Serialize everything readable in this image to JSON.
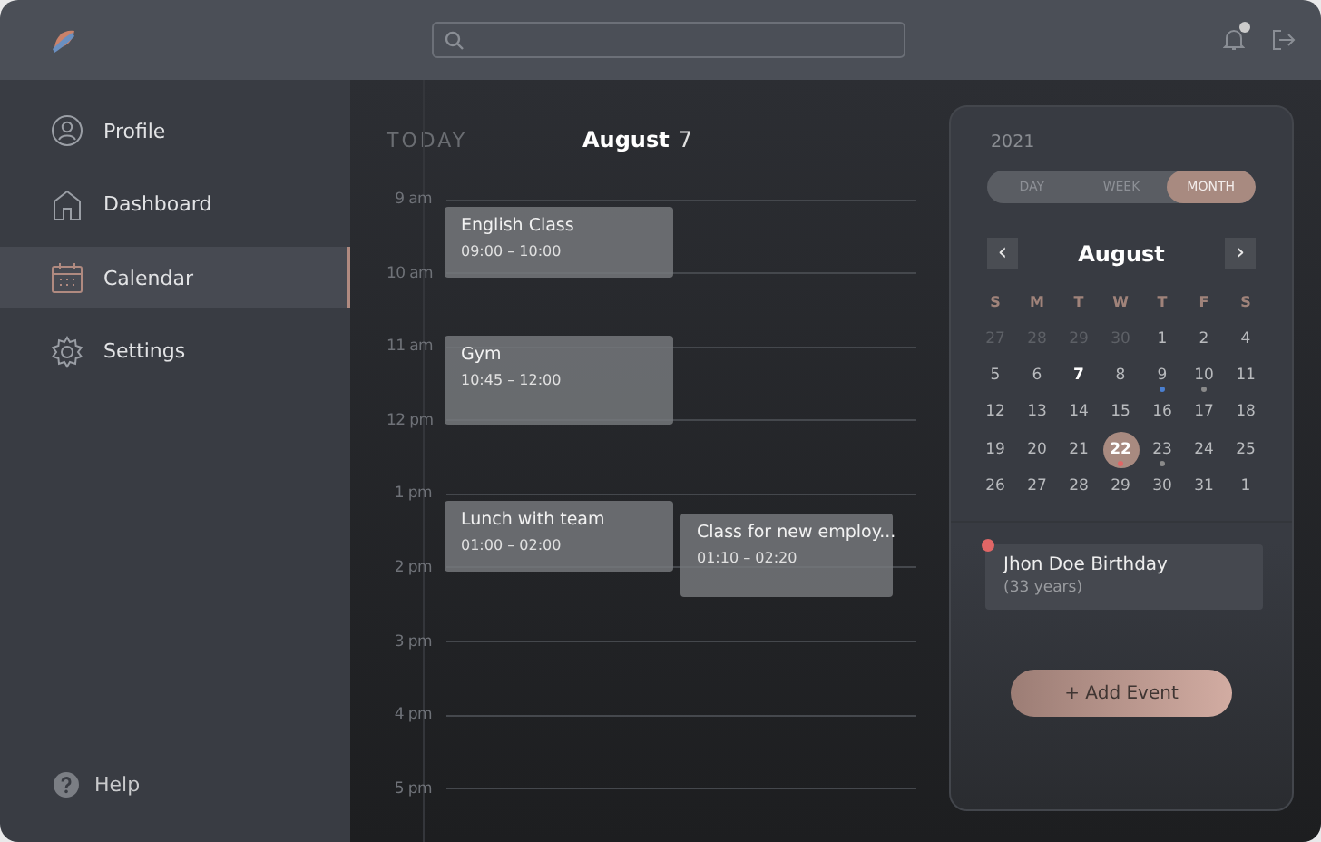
{
  "sidebar": {
    "items": [
      {
        "kind": "profile",
        "label": "Profile",
        "selected": false
      },
      {
        "kind": "dashboard",
        "label": "Dashboard",
        "selected": false
      },
      {
        "kind": "calendar",
        "label": "Calendar",
        "selected": true
      },
      {
        "kind": "settings",
        "label": "Settings",
        "selected": false
      }
    ],
    "help": "Help"
  },
  "day_view": {
    "today_label": "TODAY",
    "month": "August",
    "day": "7",
    "hours": [
      "9 am",
      "10 am",
      "11 am",
      "12 pm",
      "1 pm",
      "2 pm",
      "3 pm",
      "4 pm",
      "5 pm"
    ],
    "events": [
      {
        "title": "English Class",
        "time": "09:00 – 10:00"
      },
      {
        "title": "Gym",
        "time": "10:45 – 12:00"
      },
      {
        "title": "Lunch with team",
        "time": "01:00 – 02:00"
      },
      {
        "title": "Class for new employ...",
        "time": "01:10 – 02:20"
      }
    ]
  },
  "month_panel": {
    "year": "2021",
    "views": [
      {
        "label": "DAY",
        "selected": false
      },
      {
        "label": "WEEK",
        "selected": false
      },
      {
        "label": "MONTH",
        "selected": true
      }
    ],
    "prev": "‹",
    "month": "August",
    "next": "›",
    "weekdays": [
      "S",
      "M",
      "T",
      "W",
      "T",
      "F",
      "S"
    ],
    "days": [
      {
        "day": "27",
        "dimmed": true,
        "today": false,
        "selected": false
      },
      {
        "day": "28",
        "dimmed": true,
        "today": false,
        "selected": false
      },
      {
        "day": "29",
        "dimmed": true,
        "today": false,
        "selected": false
      },
      {
        "day": "30",
        "dimmed": true,
        "today": false,
        "selected": false
      },
      {
        "day": "1",
        "dimmed": false,
        "today": false,
        "selected": false
      },
      {
        "day": "2",
        "dimmed": false,
        "today": false,
        "selected": false
      },
      {
        "day": "4",
        "dimmed": false,
        "today": false,
        "selected": false
      },
      {
        "day": "5",
        "dimmed": false,
        "today": false,
        "selected": false
      },
      {
        "day": "6",
        "dimmed": false,
        "today": false,
        "selected": false
      },
      {
        "day": "7",
        "dimmed": false,
        "today": true,
        "selected": false
      },
      {
        "day": "8",
        "dimmed": false,
        "today": false,
        "selected": false
      },
      {
        "day": "9",
        "dimmed": false,
        "today": false,
        "selected": false,
        "color": "#4a7fd0"
      },
      {
        "day": "10",
        "dimmed": false,
        "today": false,
        "selected": false,
        "color": "#8a8a8a"
      },
      {
        "day": "11",
        "dimmed": false,
        "today": false,
        "selected": false
      },
      {
        "day": "12",
        "dimmed": false,
        "today": false,
        "selected": false
      },
      {
        "day": "13",
        "dimmed": false,
        "today": false,
        "selected": false
      },
      {
        "day": "14",
        "dimmed": false,
        "today": false,
        "selected": false
      },
      {
        "day": "15",
        "dimmed": false,
        "today": false,
        "selected": false
      },
      {
        "day": "16",
        "dimmed": false,
        "today": false,
        "selected": false
      },
      {
        "day": "17",
        "dimmed": false,
        "today": false,
        "selected": false
      },
      {
        "day": "18",
        "dimmed": false,
        "today": false,
        "selected": false
      },
      {
        "day": "19",
        "dimmed": false,
        "today": false,
        "selected": false
      },
      {
        "day": "20",
        "dimmed": false,
        "today": false,
        "selected": false
      },
      {
        "day": "21",
        "dimmed": false,
        "today": false,
        "selected": false
      },
      {
        "day": "22",
        "dimmed": false,
        "today": false,
        "selected": true,
        "color": "#e06666"
      },
      {
        "day": "23",
        "dimmed": false,
        "today": false,
        "selected": false,
        "color": "#8a8a8a"
      },
      {
        "day": "24",
        "dimmed": false,
        "today": false,
        "selected": false
      },
      {
        "day": "25",
        "dimmed": false,
        "today": false,
        "selected": false
      },
      {
        "day": "26",
        "dimmed": false,
        "today": false,
        "selected": false
      },
      {
        "day": "27",
        "dimmed": false,
        "today": false,
        "selected": false
      },
      {
        "day": "28",
        "dimmed": false,
        "today": false,
        "selected": false
      },
      {
        "day": "29",
        "dimmed": false,
        "today": false,
        "selected": false
      },
      {
        "day": "30",
        "dimmed": false,
        "today": false,
        "selected": false
      },
      {
        "day": "31",
        "dimmed": false,
        "today": false,
        "selected": false
      },
      {
        "day": "1",
        "dimmed": false,
        "today": false,
        "selected": false
      }
    ],
    "reminders": [
      {
        "title": "Jhon Doe Birthday",
        "detail": "(33 years)",
        "color": "#e06666"
      }
    ],
    "add_button": "+ Add Event"
  }
}
